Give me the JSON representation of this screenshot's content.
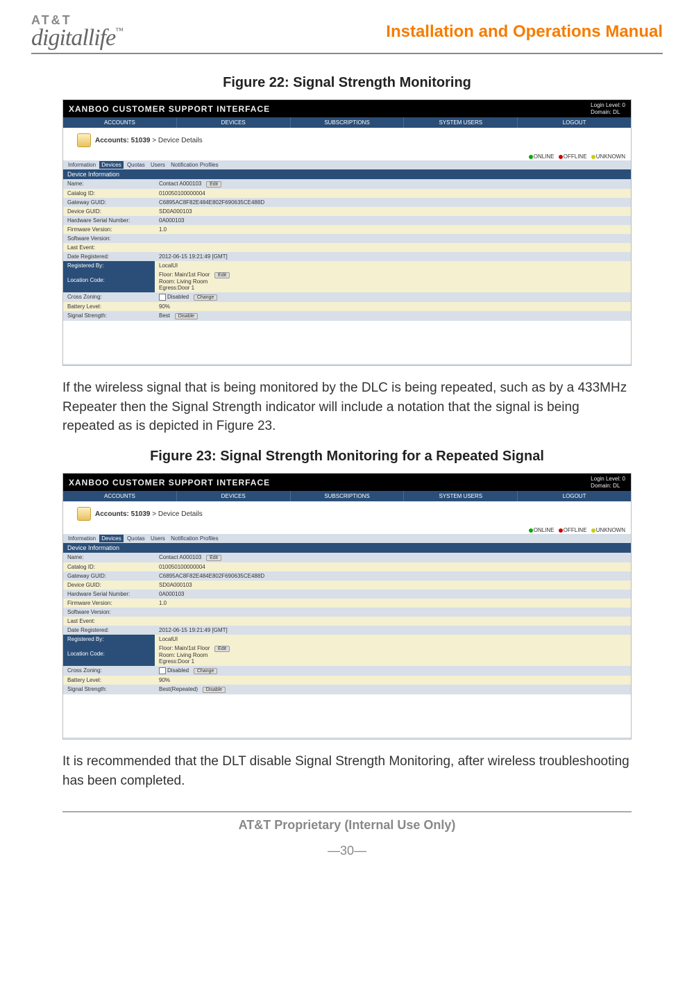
{
  "header": {
    "logo_top": "AT&T",
    "logo_bottom": "digitallife",
    "logo_tm": "™",
    "doc_title": "Installation and Operations Manual"
  },
  "figure22_title": "Figure 22: Signal Strength Monitoring",
  "paragraph1": "If the wireless signal that is being monitored by the DLC is being repeated, such as by a 433MHz Repeater then the Signal Strength indicator will include a notation that the signal is being repeated as is depicted in Figure 23.",
  "figure23_title": "Figure 23: Signal Strength Monitoring for a Repeated Signal",
  "paragraph2": "It is recommended that the DLT disable Signal Strength Monitoring, after wireless troubleshooting has been completed.",
  "footer": {
    "proprietary": "AT&T Proprietary (Internal Use Only)",
    "page_num": "—30—"
  },
  "xanboo": {
    "brand": "XANBOO",
    "brand_sub": " CUSTOMER SUPPORT INTERFACE",
    "login_level": "Login Level: 0",
    "domain": "Domain: DL",
    "nav": [
      "ACCOUNTS",
      "DEVICES",
      "SUBSCRIPTIONS",
      "SYSTEM USERS",
      "LOGOUT"
    ],
    "account_label": "Accounts: 51039",
    "account_sub": " > Device Details",
    "status_online": "ONLINE",
    "status_offline": "OFFLINE",
    "status_unknown": "UNKNOWN",
    "tabs": [
      "Information",
      "Devices",
      "Quotas",
      "Users",
      "Notification Profiles"
    ],
    "section": "Device Information",
    "btn_edit": "Edit",
    "btn_change": "Change",
    "btn_disable": "Disable",
    "rows": {
      "name_l": "Name:",
      "name_v": "Contact A000103",
      "cat_l": "Catalog ID:",
      "cat_v": "010050100000004",
      "gguid_l": "Gateway GUID:",
      "gguid_v": "C6895AC8F82E484E802F690635CE488D",
      "dguid_l": "Device GUID:",
      "dguid_v": "SD0A000103",
      "hw_l": "Hardware Serial Number:",
      "hw_v": "0A000103",
      "fw_l": "Firmware Version:",
      "fw_v": "1.0",
      "sw_l": "Software Version:",
      "sw_v": "",
      "le_l": "Last Event:",
      "le_v": "",
      "dr_l": "Date Registered:",
      "dr_v": "2012-06-15 19:21:49 [GMT]",
      "rb_l": "Registered By:",
      "rb_v": "LocalUI",
      "loc_l": "Location Code:",
      "loc_floor": "Floor: Main/1st Floor",
      "loc_room": "Room: Living Room",
      "loc_egress": "Egress:Door 1",
      "cz_l": "Cross Zoning:",
      "cz_v": "Disabled",
      "bl_l": "Battery Level:",
      "bl_v": "90%",
      "ss_l": "Signal Strength:",
      "ss_v22": "Best",
      "ss_v23": "Best(Repeated)"
    }
  }
}
